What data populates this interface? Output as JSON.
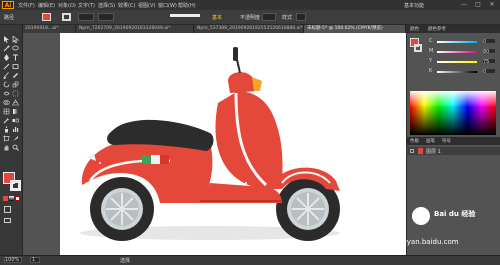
{
  "app": {
    "logo": "Ai"
  },
  "menu": {
    "items": [
      "文件(F)",
      "编辑(E)",
      "对象(O)",
      "文字(T)",
      "选择(S)",
      "效果(C)",
      "视图(V)",
      "窗口(W)",
      "帮助(H)"
    ]
  },
  "workspace": {
    "label": "基本功能"
  },
  "window_controls": [
    "—",
    "□",
    "✕"
  ],
  "control_bar": {
    "path_label": "路径",
    "stroke_style_label": "基本",
    "opacity_label": "不透明度",
    "style_label": "样式"
  },
  "doc_tabs": [
    {
      "label": "20190918...ai*",
      "active": false
    },
    {
      "label": "Npm_7262709_20190920183328049.ai*",
      "active": false
    },
    {
      "label": "Npm_537388_20190920192553526610888.ai*",
      "active": false
    },
    {
      "label": "未标题-5* @ 100.02% (CMYK/预览)",
      "active": true
    }
  ],
  "right_panel": {
    "tabs": [
      "颜色",
      "颜色参考"
    ],
    "tabs2": [
      "色板",
      "画笔",
      "符号"
    ],
    "sliders": [
      {
        "name": "C",
        "value": "0"
      },
      {
        "name": "M",
        "value": "80"
      },
      {
        "name": "Y",
        "value": "75"
      },
      {
        "name": "K",
        "value": "0"
      }
    ],
    "layer_row": "图层 1"
  },
  "status": {
    "zoom": "100%",
    "page": "1",
    "tool_label": "选择"
  },
  "watermark": {
    "text": "jingyan.baidu.com",
    "brand": "Bai du 经验"
  },
  "colors": {
    "fill": "#e4483a",
    "accent": "#ff9a00"
  }
}
